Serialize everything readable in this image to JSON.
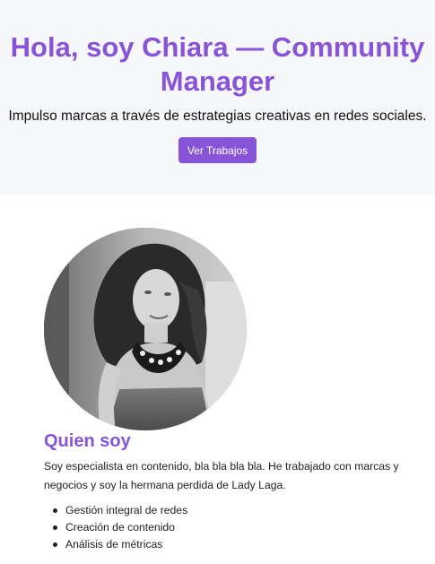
{
  "hero": {
    "title": "Hola, soy Chiara — Community Manager",
    "subtitle": "Impulso marcas a través de estrategias creativas en redes sociales.",
    "button_label": "Ver Trabajos"
  },
  "about": {
    "photo_icon": "portrait-photo",
    "title": "Quien soy",
    "text": "Soy especialista en contenido, bla bla bla bla. He trabajado con marcas y negocios y soy la hermana perdida de Lady Laga.",
    "skills": [
      "Gestión integral de redes",
      "Creación de contenido",
      "Análisis de métricas"
    ]
  },
  "colors": {
    "accent": "#8754d8",
    "hero_background": "#f6f7f9",
    "text": "#222222"
  }
}
